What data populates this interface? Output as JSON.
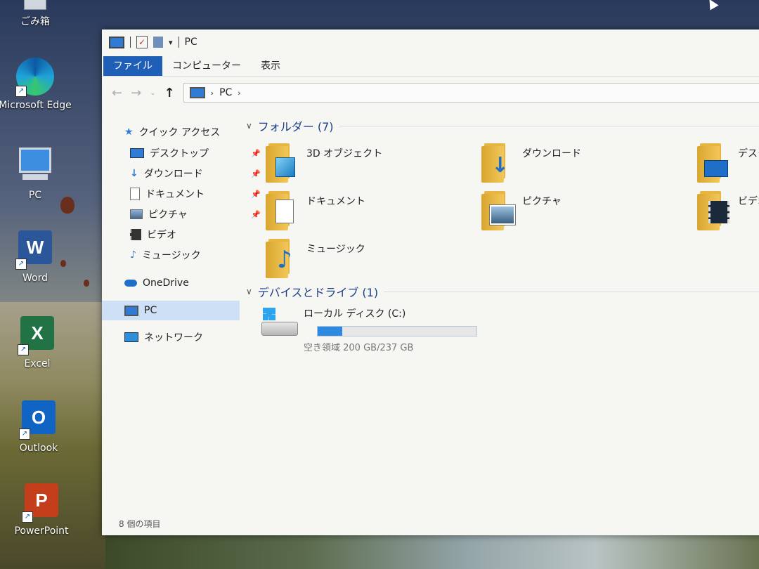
{
  "desktop": {
    "icons": [
      {
        "label": "ごみ箱"
      },
      {
        "label": "Microsoft Edge"
      },
      {
        "label": "PC"
      },
      {
        "label": "Word"
      },
      {
        "label": "Excel"
      },
      {
        "label": "Outlook"
      },
      {
        "label": "PowerPoint"
      }
    ]
  },
  "window": {
    "title": "PC",
    "ribbon_tabs": [
      "ファイル",
      "コンピューター",
      "表示"
    ],
    "address": {
      "segment": "PC"
    },
    "nav": [
      {
        "label": "クイック アクセス",
        "icon": "star-icon"
      },
      {
        "label": "デスクトップ",
        "icon": "desktop-icon",
        "pinned": true
      },
      {
        "label": "ダウンロード",
        "icon": "download-icon",
        "pinned": true
      },
      {
        "label": "ドキュメント",
        "icon": "document-icon",
        "pinned": true
      },
      {
        "label": "ピクチャ",
        "icon": "picture-icon",
        "pinned": true
      },
      {
        "label": "ビデオ",
        "icon": "video-icon"
      },
      {
        "label": "ミュージック",
        "icon": "music-icon"
      },
      {
        "label": "OneDrive",
        "icon": "cloud-icon"
      },
      {
        "label": "PC",
        "icon": "pc-icon",
        "selected": true
      },
      {
        "label": "ネットワーク",
        "icon": "network-icon"
      }
    ],
    "folders_header": "フォルダー (7)",
    "folders": [
      {
        "label": "3D オブジェクト",
        "icon": "cube-icon"
      },
      {
        "label": "ダウンロード",
        "icon": "download-icon"
      },
      {
        "label": "デスク",
        "icon": "desktop-icon"
      },
      {
        "label": "ドキュメント",
        "icon": "document-icon"
      },
      {
        "label": "ピクチャ",
        "icon": "picture-icon"
      },
      {
        "label": "ビデオ",
        "icon": "video-icon"
      },
      {
        "label": "ミュージック",
        "icon": "music-icon"
      }
    ],
    "devices_header": "デバイスとドライブ (1)",
    "drive": {
      "label": "ローカル ディスク (C:)",
      "space": "空き領域 200 GB/237 GB",
      "used_fraction": 0.156
    },
    "status": "8 個の項目",
    "colors": {
      "accent": "#1f5fb8",
      "selection": "#cde0f5",
      "drive_fill": "#2e8ae0",
      "folder": "#e8b640"
    }
  }
}
